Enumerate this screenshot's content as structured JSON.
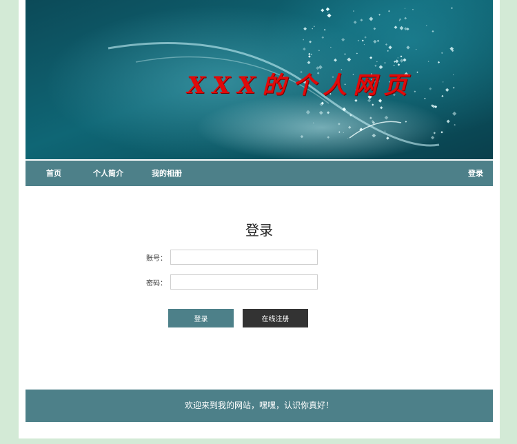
{
  "banner": {
    "title": "XXX的个人网页"
  },
  "nav": {
    "items": [
      {
        "label": "首页"
      },
      {
        "label": "个人简介"
      },
      {
        "label": "我的相册"
      }
    ],
    "login_label": "登录"
  },
  "login_form": {
    "title": "登录",
    "account_label": "账号：",
    "account_value": "",
    "password_label": "密码：",
    "password_value": "",
    "submit_label": "登录",
    "register_label": "在线注册"
  },
  "footer": {
    "text": "欢迎来到我的网站，嘿嘿，认识你真好！"
  },
  "colors": {
    "page_background": "#d3ead6",
    "accent": "#4d8089",
    "dark_button": "#333333",
    "banner_title": "#e10a0a"
  }
}
